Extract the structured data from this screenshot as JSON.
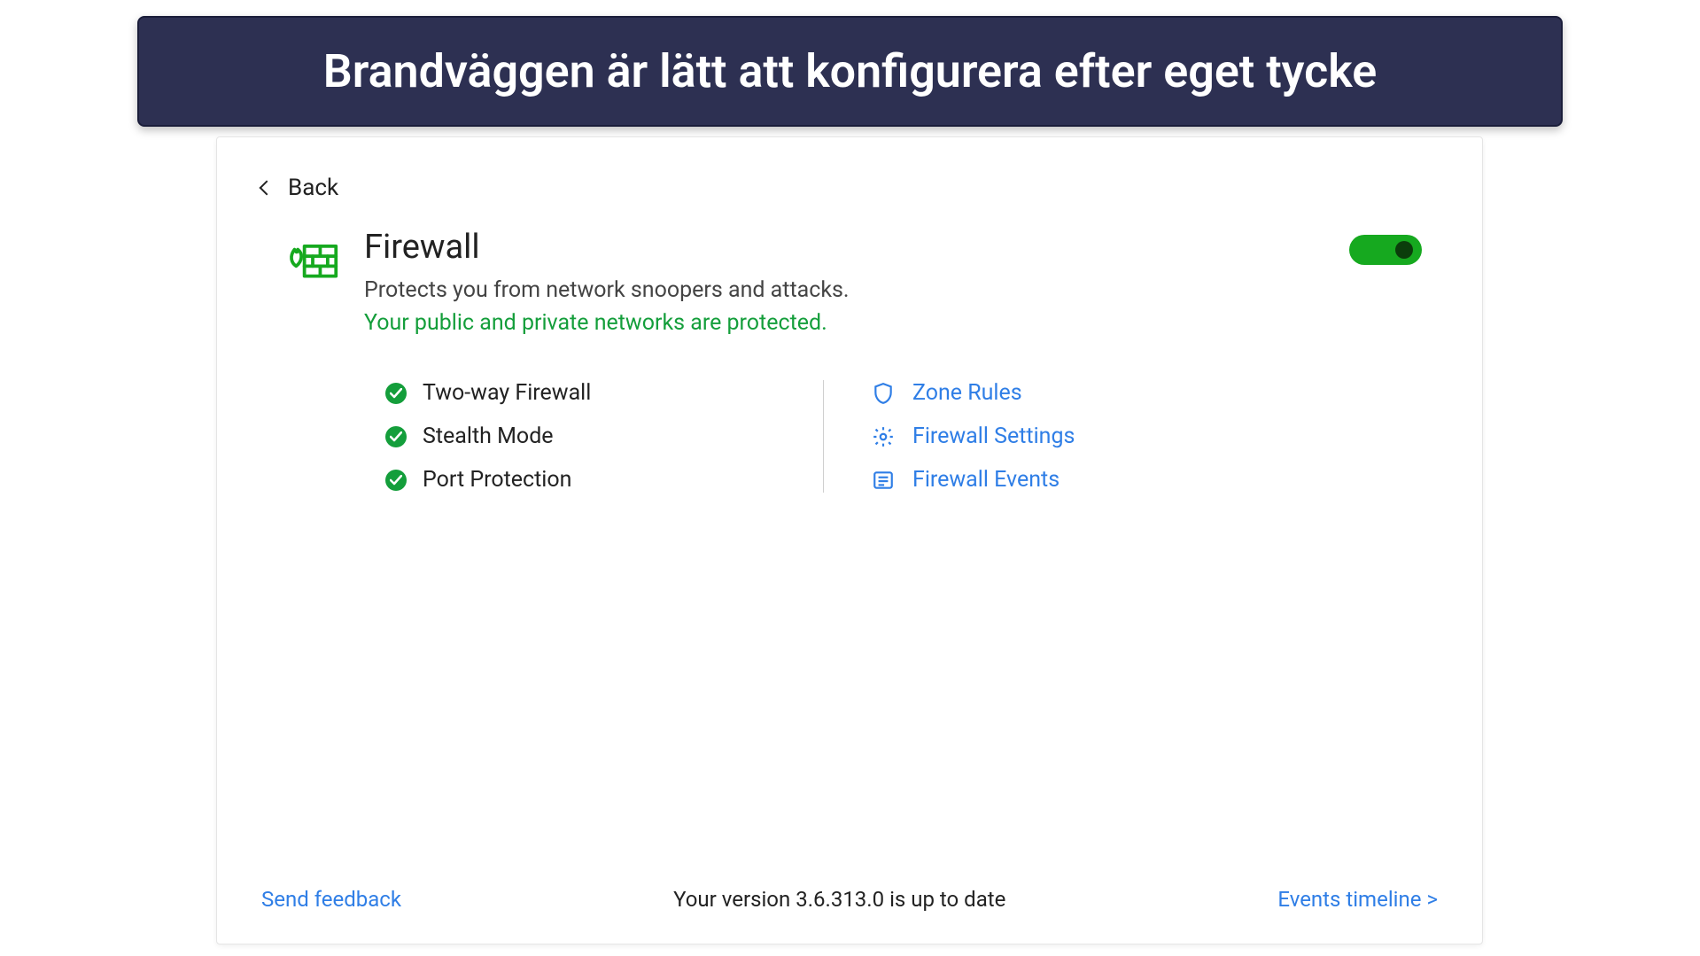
{
  "banner": {
    "title": "Brandväggen är lätt att konfigurera efter eget tycke"
  },
  "nav": {
    "back_label": "Back"
  },
  "firewall": {
    "title": "Firewall",
    "subtitle": "Protects you from network snoopers and attacks.",
    "status": "Your public and private networks are protected.",
    "toggle_on": true,
    "features": [
      {
        "label": "Two-way Firewall"
      },
      {
        "label": "Stealth Mode"
      },
      {
        "label": "Port Protection"
      }
    ],
    "links": [
      {
        "label": "Zone Rules",
        "icon": "shield"
      },
      {
        "label": "Firewall Settings",
        "icon": "gear"
      },
      {
        "label": "Firewall Events",
        "icon": "list"
      }
    ]
  },
  "footer": {
    "feedback": "Send feedback",
    "version_text": "Your version 3.6.313.0 is up to date",
    "events_link": "Events timeline >"
  },
  "colors": {
    "accent_blue": "#2f7ee6",
    "ok_green": "#149e3b",
    "banner_bg": "#2d3052"
  }
}
